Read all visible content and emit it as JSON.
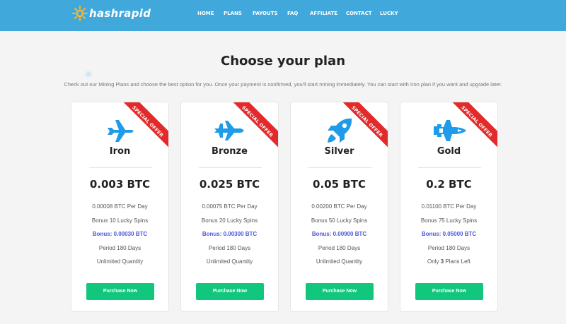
{
  "brand": {
    "name": "hashrapid"
  },
  "nav": [
    {
      "label": "HOME"
    },
    {
      "label": "PLANS"
    },
    {
      "label": "PAYOUTS"
    },
    {
      "label": "FAQ"
    },
    {
      "label": "AFFILIATE"
    },
    {
      "label": "CONTACT"
    },
    {
      "label": "LUCKY"
    }
  ],
  "main": {
    "title": "Choose your plan",
    "subtitle": "Check out our Mining Plans and choose the best option for you. Once your payment is confirmed, you'll start mining immediately. You can start with Iron plan if you want and upgrade later."
  },
  "ribbon_label": "SPECIAL OFFER",
  "plans": [
    {
      "name": "Iron",
      "icon": "airplane-icon",
      "price": "0.003 BTC",
      "per_day": "0.00008 BTC Per Day",
      "spins": "Bonus 10 Lucky Spins",
      "bonus": "Bonus: 0.00030 BTC",
      "period": "Period 180 Days",
      "quantity": "Unlimited Quantity",
      "button": "Purchase Now"
    },
    {
      "name": "Bronze",
      "icon": "fighter-jet-icon",
      "price": "0.025 BTC",
      "per_day": "0.00075 BTC Per Day",
      "spins": "Bonus 20 Lucky Spins",
      "bonus": "Bonus: 0.00300 BTC",
      "period": "Period 180 Days",
      "quantity": "Unlimited Quantity",
      "button": "Purchase Now"
    },
    {
      "name": "Silver",
      "icon": "rocket-icon",
      "price": "0.05 BTC",
      "per_day": "0.00200 BTC Per Day",
      "spins": "Bonus 50 Lucky Spins",
      "bonus": "Bonus: 0.00900 BTC",
      "period": "Period 180 Days",
      "quantity": "Unlimited Quantity",
      "button": "Purchase Now"
    },
    {
      "name": "Gold",
      "icon": "space-shuttle-icon",
      "price": "0.2 BTC",
      "per_day": "0.01100 BTC Per Day",
      "spins": "Bonus 75 Lucky Spins",
      "bonus": "Bonus: 0.05000 BTC",
      "period": "Period 180 Days",
      "quantity_prefix": "Only ",
      "quantity_count": "3",
      "quantity_suffix": " Plans Left",
      "button": "Purchase Now"
    }
  ],
  "colors": {
    "header": "#41a8dc",
    "icon": "#1e9be9",
    "ribbon": "#e32a2a",
    "bonus": "#4a55d6",
    "button": "#10c77d"
  }
}
